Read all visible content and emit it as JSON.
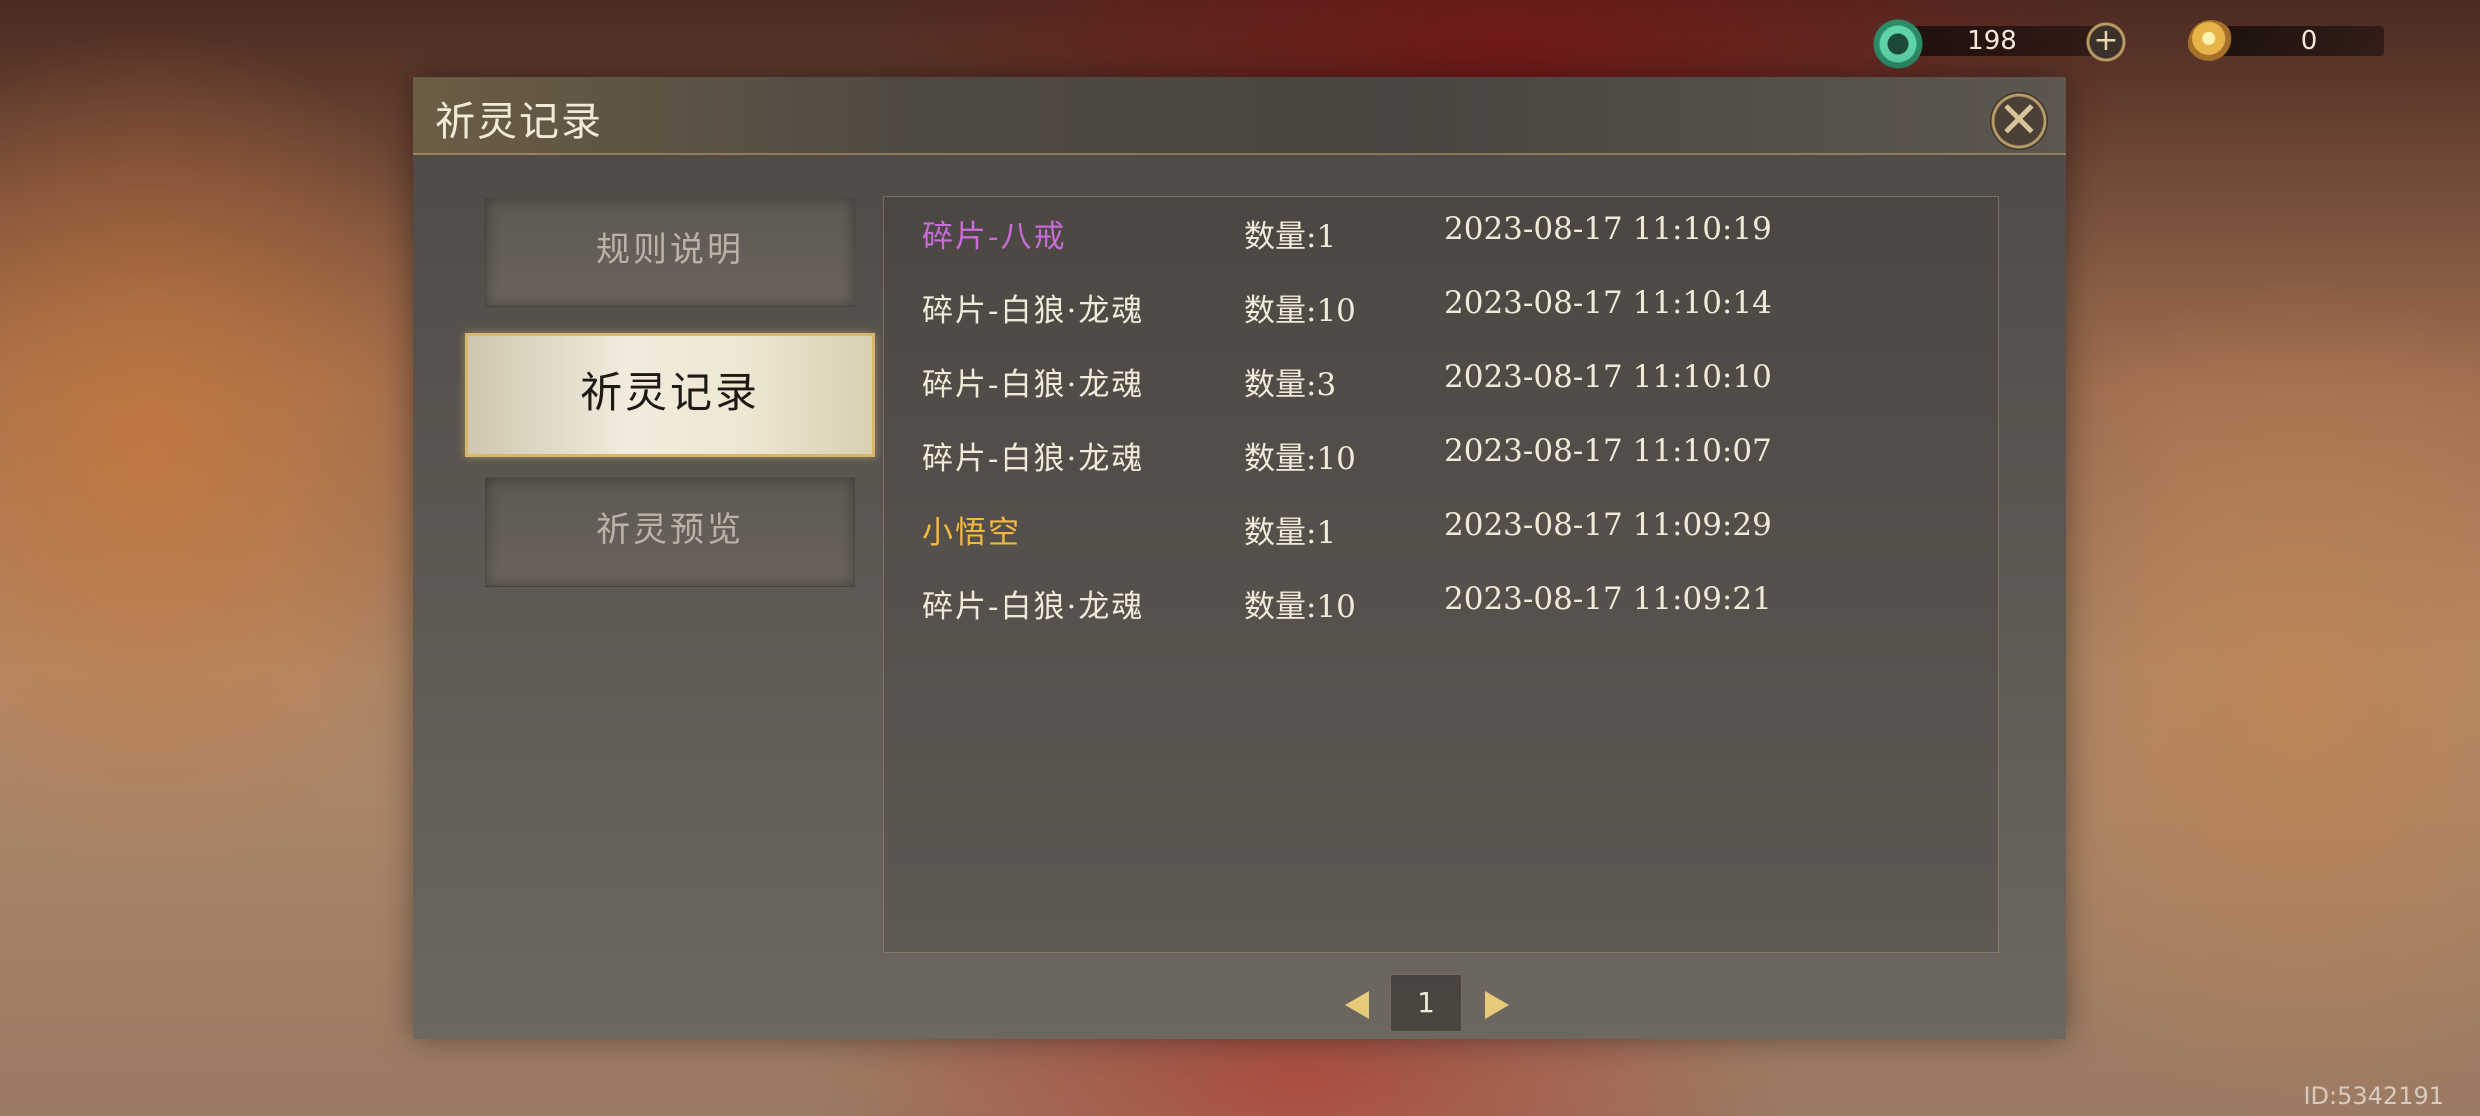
{
  "currencies": {
    "jade": {
      "value": "198",
      "icon": "jade-dragon-icon",
      "add_label": "+"
    },
    "gold": {
      "value": "0",
      "icon": "gold-coin-icon"
    }
  },
  "dialog": {
    "title": "祈灵记录",
    "close_label": "✕"
  },
  "sidebar": {
    "items": [
      {
        "label": "规则说明",
        "active": false
      },
      {
        "label": "祈灵记录",
        "active": true
      },
      {
        "label": "祈灵预览",
        "active": false
      }
    ]
  },
  "records": [
    {
      "name": "碎片-八戒",
      "qty": "数量:1",
      "time": "2023-08-17 11:10:19",
      "color": "#c86bd8"
    },
    {
      "name": "碎片-白狼·龙魂",
      "qty": "数量:10",
      "time": "2023-08-17 11:10:14",
      "color": "#f0ead9"
    },
    {
      "name": "碎片-白狼·龙魂",
      "qty": "数量:3",
      "time": "2023-08-17 11:10:10",
      "color": "#f0ead9"
    },
    {
      "name": "碎片-白狼·龙魂",
      "qty": "数量:10",
      "time": "2023-08-17 11:10:07",
      "color": "#f0ead9"
    },
    {
      "name": "小悟空",
      "qty": "数量:1",
      "time": "2023-08-17 11:09:29",
      "color": "#f2b840"
    },
    {
      "name": "碎片-白狼·龙魂",
      "qty": "数量:10",
      "time": "2023-08-17 11:09:21",
      "color": "#f0ead9"
    }
  ],
  "pager": {
    "page": "1"
  },
  "footer": {
    "uid": "ID:5342191"
  }
}
